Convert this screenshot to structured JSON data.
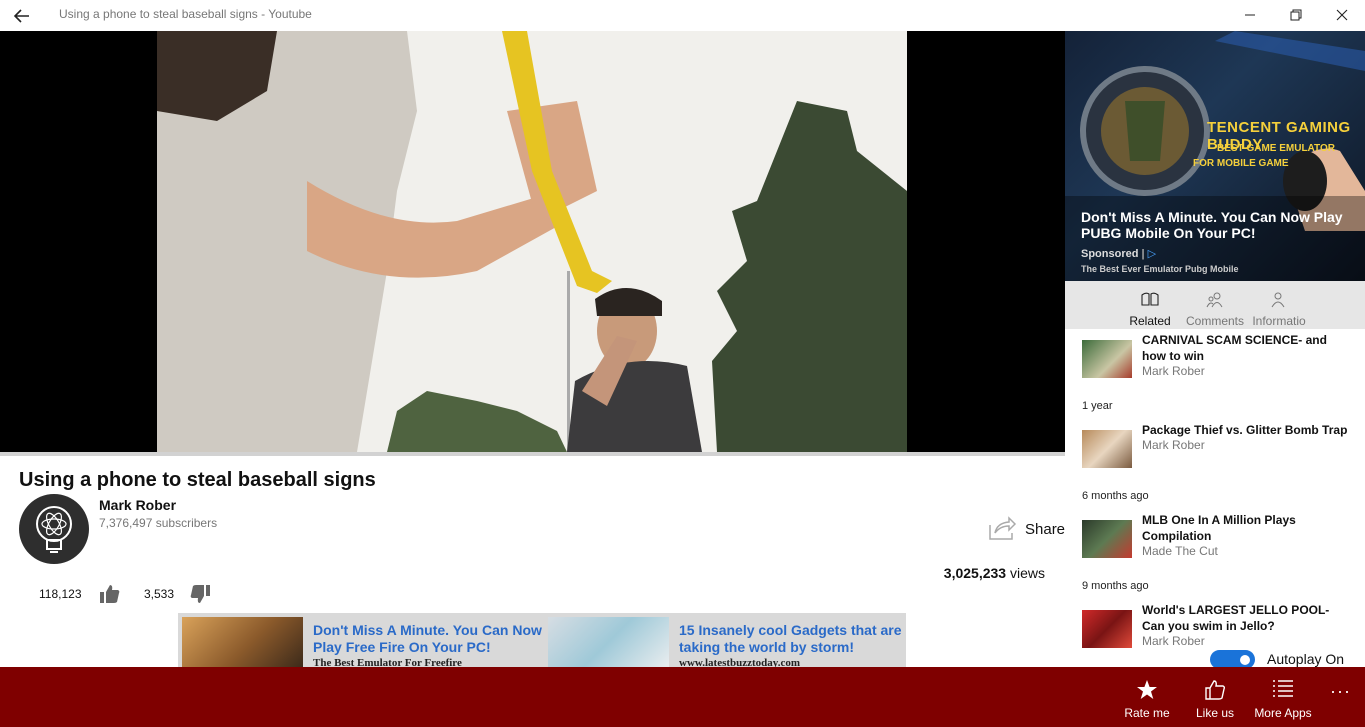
{
  "window": {
    "title": "Using a phone to steal baseball signs - Youtube"
  },
  "video": {
    "title": "Using a phone to steal baseball signs",
    "channel": "Mark Rober",
    "subscribers": "7,376,497 subscribers",
    "share_label": "Share",
    "views_count": "3,025,233",
    "views_suffix": " views",
    "likes": "118,123",
    "dislikes": "3,533"
  },
  "bottom_ads": [
    {
      "headline": "Don't Miss A Minute. You Can Now Play Free Fire On Your PC!",
      "caption": "The Best Emulator For Freefire"
    },
    {
      "headline": "15 Insanely cool Gadgets that are taking the world by storm!",
      "caption": "www.latestbuzztoday.com"
    }
  ],
  "side_ad": {
    "brand": "TENCENT GAMING BUDDY",
    "sub1": "BEST GAME EMULATOR",
    "sub2": "FOR MOBILE GAME",
    "headline": "Don't Miss A Minute. You Can Now Play PUBG Mobile On Your PC!",
    "sponsored": "Sponsored",
    "footer": "The Best Ever Emulator Pubg Mobile"
  },
  "tabs": [
    {
      "label": "Related",
      "icon": "book-icon",
      "active": true
    },
    {
      "label": "Comments",
      "icon": "people-icon",
      "active": false
    },
    {
      "label": "Informatio",
      "icon": "person-icon",
      "active": false
    }
  ],
  "related": [
    {
      "title": "CARNIVAL SCAM SCIENCE- and how to win",
      "channel": "Mark Rober",
      "date": "1 year"
    },
    {
      "title": "Package Thief vs. Glitter Bomb Trap",
      "channel": "Mark Rober",
      "date": "6 months ago"
    },
    {
      "title": "MLB One In A Million Plays Compilation",
      "channel": "Made The Cut",
      "date": "9 months ago"
    },
    {
      "title": "World's LARGEST JELLO POOL- Can you swim in Jello?",
      "channel": "Mark Rober",
      "date": ""
    }
  ],
  "autoplay": {
    "label": "Autoplay On",
    "on": true
  },
  "appbar": {
    "rate_label": "Rate me",
    "like_label": "Like us",
    "more_apps_label": "More Apps",
    "overflow": "···"
  },
  "colors": {
    "appbar": "#7f0000",
    "link": "#2a6ac8",
    "toggle": "#1a73d9"
  }
}
